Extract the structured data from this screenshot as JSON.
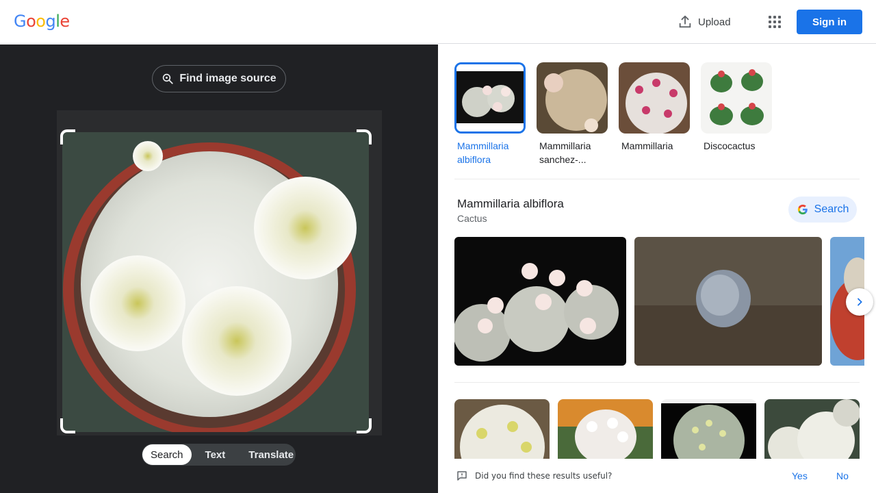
{
  "header": {
    "logo_letters": [
      "G",
      "o",
      "o",
      "g",
      "l",
      "e"
    ],
    "logo_colors": [
      "#4285f4",
      "#ea4335",
      "#fbbc05",
      "#4285f4",
      "#34a853",
      "#ea4335"
    ],
    "upload_label": "Upload",
    "apps_icon": "apps-grid-icon",
    "sign_in_label": "Sign in"
  },
  "left_pane": {
    "find_source_label": "Find image source",
    "modes": [
      {
        "label": "Search",
        "active": true
      },
      {
        "label": "Text",
        "active": false
      },
      {
        "label": "Translate",
        "active": false
      }
    ]
  },
  "right_pane": {
    "suggestions": [
      {
        "label": "Mammillaria albiflora",
        "selected": true
      },
      {
        "label": "Mammillaria sanchez-...",
        "selected": false
      },
      {
        "label": "Mammillaria",
        "selected": false
      },
      {
        "label": "Discocactus",
        "selected": false
      }
    ],
    "entity": {
      "title": "Mammillaria albiflora",
      "subtitle": "Cactus",
      "search_label": "Search"
    },
    "feedback": {
      "question": "Did you find these results useful?",
      "yes_label": "Yes",
      "no_label": "No"
    }
  },
  "colors": {
    "accent": "#1a73e8",
    "dark_pane": "#202124"
  }
}
